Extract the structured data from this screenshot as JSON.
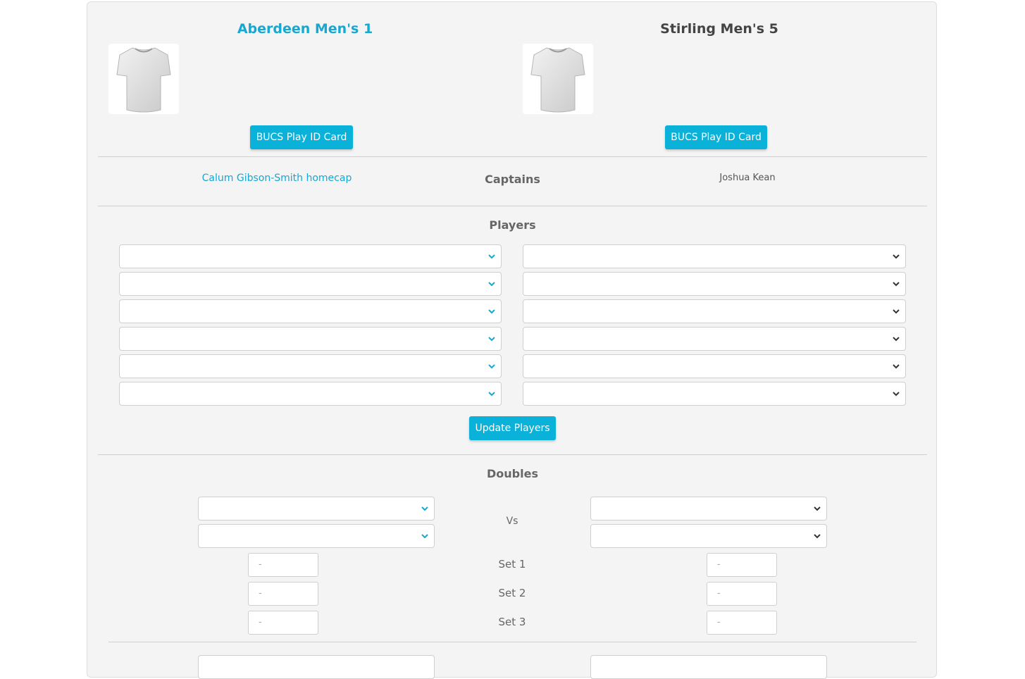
{
  "home": {
    "team_name": "Aberdeen Men's 1",
    "id_card_label": "BUCS Play ID Card",
    "captain": "Calum Gibson-Smith homecap",
    "player_selects": [
      "",
      "",
      "",
      "",
      "",
      ""
    ]
  },
  "away": {
    "team_name": "Stirling Men's 5",
    "id_card_label": "BUCS Play ID Card",
    "captain": "Joshua Kean",
    "player_selects": [
      "",
      "",
      "",
      "",
      "",
      ""
    ]
  },
  "captains_heading": "Captains",
  "players_heading": "Players",
  "update_players_label": "Update Players",
  "doubles": {
    "heading": "Doubles",
    "vs_label": "Vs",
    "sets": [
      {
        "label": "Set 1",
        "home_placeholder": "-",
        "away_placeholder": "-"
      },
      {
        "label": "Set 2",
        "home_placeholder": "-",
        "away_placeholder": "-"
      },
      {
        "label": "Set 3",
        "home_placeholder": "-",
        "away_placeholder": "-"
      }
    ]
  },
  "colors": {
    "accent": "#0ab1d9",
    "link": "#17a8d1",
    "card_background": "#f4f4f4"
  },
  "icons": [
    "t-shirt-icon",
    "chevron-down-icon"
  ]
}
